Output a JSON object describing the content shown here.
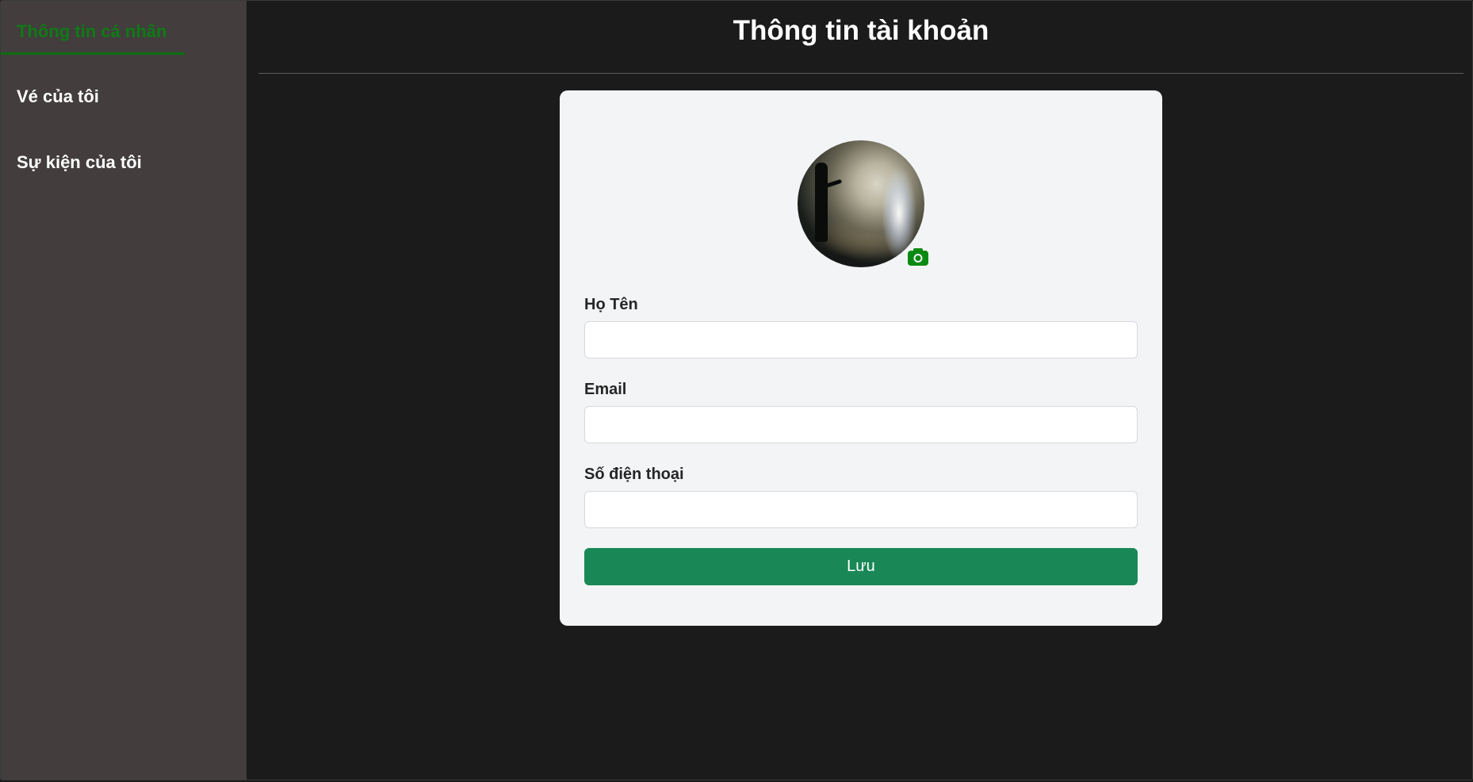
{
  "sidebar": {
    "items": [
      {
        "label": "Thông tin cá nhân",
        "active": true
      },
      {
        "label": "Vé của tôi",
        "active": false
      },
      {
        "label": "Sự kiện của tôi",
        "active": false
      }
    ]
  },
  "main": {
    "title": "Thông tin tài khoản"
  },
  "profile": {
    "avatar_icon": "camera-icon",
    "fields": [
      {
        "label": "Họ Tên",
        "value": "",
        "placeholder": ""
      },
      {
        "label": "Email",
        "value": "",
        "placeholder": ""
      },
      {
        "label": "Số điện thoại",
        "value": "",
        "placeholder": ""
      }
    ],
    "save_label": "Lưu"
  },
  "colors": {
    "active_nav": "#0f7a16",
    "sidebar_bg": "#433d3d",
    "page_bg": "#1b1b1b",
    "card_bg": "#f3f4f6",
    "primary_button": "#1a8856",
    "camera_icon": "#0a8a12"
  }
}
